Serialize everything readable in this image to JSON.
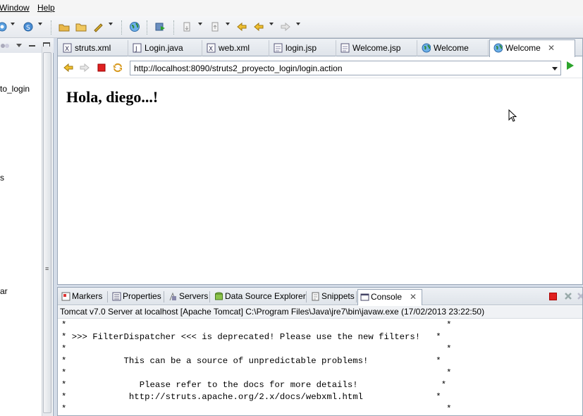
{
  "menu": [
    "Window",
    "Help"
  ],
  "left_panel": {
    "items": [
      "to_login",
      "s",
      "ar"
    ]
  },
  "editor_tabs": [
    {
      "label": "struts.xml",
      "icon": "xml-file-icon"
    },
    {
      "label": "Login.java",
      "icon": "java-file-icon"
    },
    {
      "label": "web.xml",
      "icon": "xml-file-icon"
    },
    {
      "label": "login.jsp",
      "icon": "jsp-file-icon"
    },
    {
      "label": "Welcome.jsp",
      "icon": "jsp-file-icon"
    },
    {
      "label": "Welcome",
      "icon": "globe-icon"
    },
    {
      "label": "Welcome",
      "icon": "globe-icon",
      "active": true
    }
  ],
  "browser": {
    "url": "http://localhost:8090/struts2_proyecto_login/login.action",
    "page_heading": "Hola, diego...!"
  },
  "console_tabs": [
    "Markers",
    "Properties",
    "Servers",
    "Data Source Explorer",
    "Snippets",
    "Console"
  ],
  "console": {
    "description": "Tomcat v7.0 Server at localhost [Apache Tomcat] C:\\Program Files\\Java\\jre7\\bin\\javaw.exe (17/02/2013 23:22:50)",
    "lines": [
      "*                                                                         *",
      "* >>> FilterDispatcher <<< is deprecated! Please use the new filters!   *",
      "*                                                                         *",
      "*           This can be a source of unpredictable problems!             *",
      "*                                                                         *",
      "*              Please refer to the docs for more details!                *",
      "*            http://struts.apache.org/2.x/docs/webxml.html              *",
      "*                                                                         *"
    ]
  },
  "colors": {
    "stop": "#e02020",
    "go": "#2ca42c",
    "chrome": "#d4dce8"
  }
}
